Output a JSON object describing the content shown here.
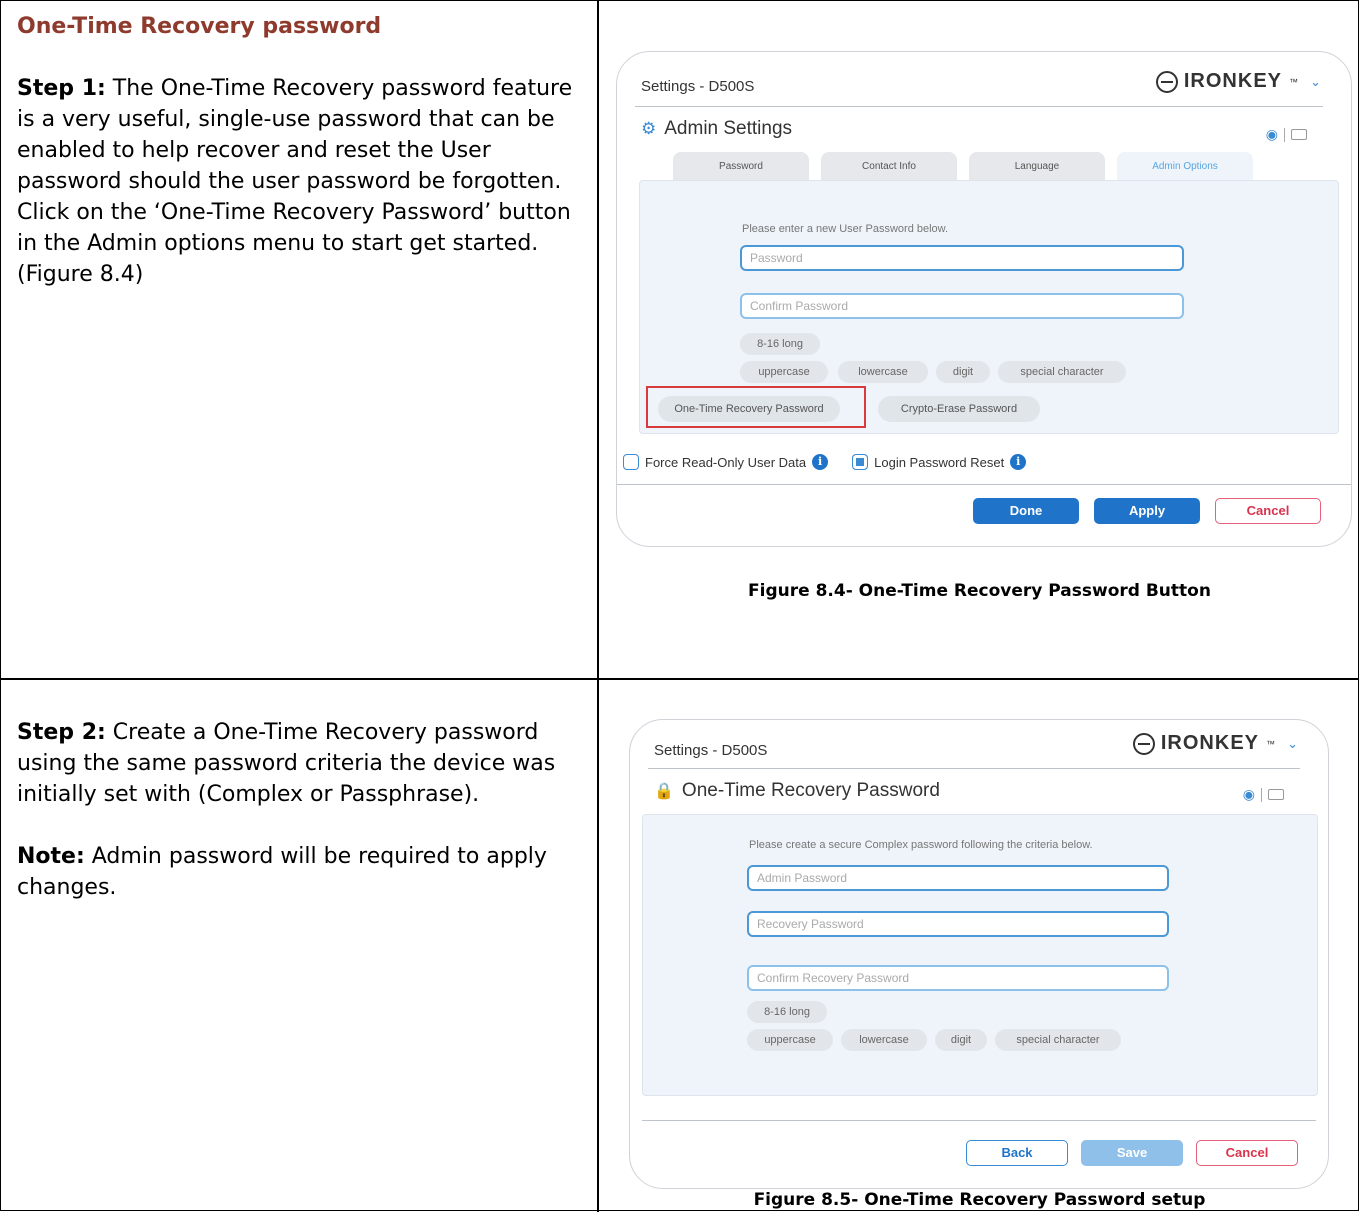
{
  "section_title": "One-Time Recovery password",
  "step1": {
    "label": "Step 1:",
    "text": "The One-Time Recovery password feature is a very useful, single-use password that can be enabled to help recover and reset the User password should the user password be forgotten.  Click on the ‘One-Time Recovery Password’ button in the Admin options menu to start get started.   (Figure 8.4)"
  },
  "step2": {
    "label": "Step 2:",
    "text": "Create a One-Time Recovery password using the same password criteria the device was initially set with (Complex or Passphrase).",
    "note_label": "Note:",
    "note_text": "Admin password will be required to apply changes."
  },
  "figure1": {
    "caption": "Figure 8.4- One-Time Recovery Password Button",
    "window_title": "Settings - D500S",
    "brand": "IRONKEY",
    "brand_tm": "™",
    "heading": "Admin Settings",
    "tabs": [
      "Password",
      "Contact Info",
      "Language",
      "Admin Options"
    ],
    "prompt": "Please enter a new User Password below.",
    "password_placeholder": "Password",
    "confirm_placeholder": "Confirm Password",
    "length_pill": "8-16 long",
    "criteria": [
      "uppercase",
      "lowercase",
      "digit",
      "special character"
    ],
    "otr_button": "One-Time Recovery Password",
    "crypto_button": "Crypto-Erase Password",
    "force_readonly": "Force Read-Only User Data",
    "login_reset": "Login Password Reset",
    "done": "Done",
    "apply": "Apply",
    "cancel": "Cancel"
  },
  "figure2": {
    "caption": "Figure 8.5- One-Time Recovery Password setup",
    "window_title": "Settings - D500S",
    "brand": "IRONKEY",
    "brand_tm": "™",
    "heading": "One-Time Recovery Password",
    "prompt": "Please create a secure Complex password following the criteria below.",
    "admin_placeholder": "Admin Password",
    "recovery_placeholder": "Recovery Password",
    "confirm_placeholder": "Confirm Recovery Password",
    "length_pill": "8-16 long",
    "criteria": [
      "uppercase",
      "lowercase",
      "digit",
      "special character"
    ],
    "back": "Back",
    "save": "Save",
    "cancel": "Cancel"
  },
  "colors": {
    "section_title": "#8e3b2e",
    "accent_blue": "#1f74c9",
    "highlight_red": "#d83b3b"
  }
}
